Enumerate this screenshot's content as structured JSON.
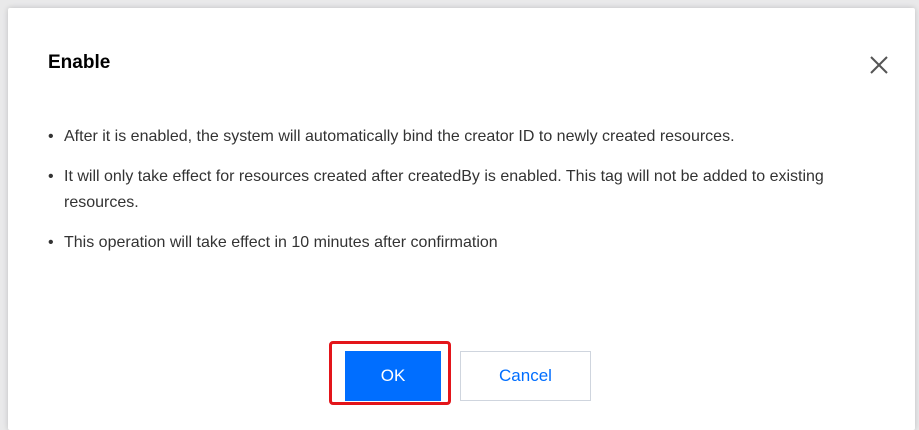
{
  "dialog": {
    "title": "Enable",
    "close_icon": "close-icon",
    "bullets": [
      "After it is enabled, the system will automatically bind the creator ID to newly created resources.",
      "It will only take effect for resources created after createdBy is enabled. This tag will not be added to existing resources.",
      "This operation will take effect in 10 minutes after confirmation"
    ],
    "bullet_glyph": "•",
    "ok_label": "OK",
    "cancel_label": "Cancel"
  },
  "colors": {
    "primary": "#006eff",
    "highlight": "#e3151a",
    "text": "#333333"
  }
}
